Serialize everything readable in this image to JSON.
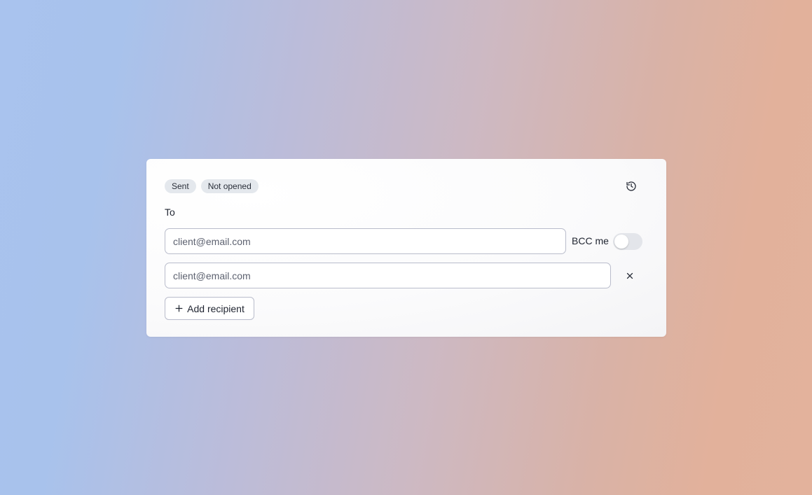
{
  "status_badges": [
    {
      "label": "Sent"
    },
    {
      "label": "Not opened"
    }
  ],
  "icons": {
    "history": "history-icon",
    "remove": "close-icon",
    "add": "plus-icon"
  },
  "recipients": {
    "label": "To",
    "fields": [
      {
        "placeholder": "client@email.com",
        "value": ""
      },
      {
        "placeholder": "client@email.com",
        "value": ""
      }
    ],
    "bcc_label": "BCC me",
    "bcc_enabled": false,
    "add_label": "Add recipient"
  },
  "colors": {
    "badge_bg": "#e4e8ed",
    "field_border": "#b9bccb",
    "text": "#1f2430"
  }
}
